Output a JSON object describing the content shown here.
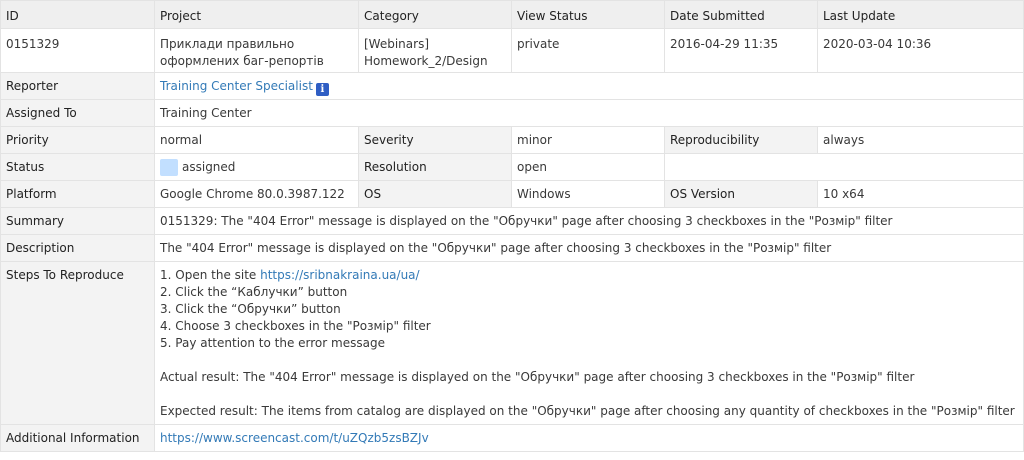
{
  "headers": {
    "id": "ID",
    "project": "Project",
    "category": "Category",
    "view_status": "View Status",
    "date_submitted": "Date Submitted",
    "last_update": "Last Update"
  },
  "issue": {
    "id": "0151329",
    "project": "Приклади правильно оформлених баг-репортів",
    "category": "[Webinars] Homework_2/Design",
    "view_status": "private",
    "date_submitted": "2016-04-29 11:35",
    "last_update": "2020-03-04 10:36"
  },
  "labels": {
    "reporter": "Reporter",
    "assigned_to": "Assigned To",
    "priority": "Priority",
    "severity": "Severity",
    "reproducibility": "Reproducibility",
    "status": "Status",
    "resolution": "Resolution",
    "platform": "Platform",
    "os": "OS",
    "os_version": "OS Version",
    "summary": "Summary",
    "description": "Description",
    "steps": "Steps To Reproduce",
    "additional_info": "Additional Information"
  },
  "values": {
    "reporter": "Training Center Specialist",
    "reporter_info_icon": "info-icon",
    "assigned_to": "Training Center",
    "priority": "normal",
    "severity": "minor",
    "reproducibility": "always",
    "status": "assigned",
    "status_color": "#c2dfff",
    "resolution": "open",
    "platform": "Google Chrome 80.0.3987.122",
    "os": "Windows",
    "os_version": "10 x64",
    "summary": "0151329: The \"404 Error\" message is displayed on the \"Обручки\" page after choosing 3 checkboxes in the \"Розмір\" filter",
    "description": "The \"404 Error\" message is displayed on the \"Обручки\" page after choosing 3 checkboxes in the \"Розмір\" filter",
    "steps": {
      "step1_prefix": "1. Open the site ",
      "step1_link": "https://sribnakraina.ua/ua/",
      "step2": "2. Click the “Каблучки” button",
      "step3": "3. Click the “Обручки” button",
      "step4": "4. Choose 3 checkboxes in the \"Розмір\" filter",
      "step5": "5. Pay attention to the error message",
      "actual": "Actual result: The \"404 Error\" message is displayed on the \"Обручки\" page after choosing 3 checkboxes in the \"Розмір\" filter",
      "expected": "Expected result: The items from catalog are displayed on the \"Обручки\" page after choosing any quantity of checkboxes in the \"Розмір\" filter"
    },
    "additional_info": "https://www.screencast.com/t/uZQzb5zsBZJv"
  }
}
